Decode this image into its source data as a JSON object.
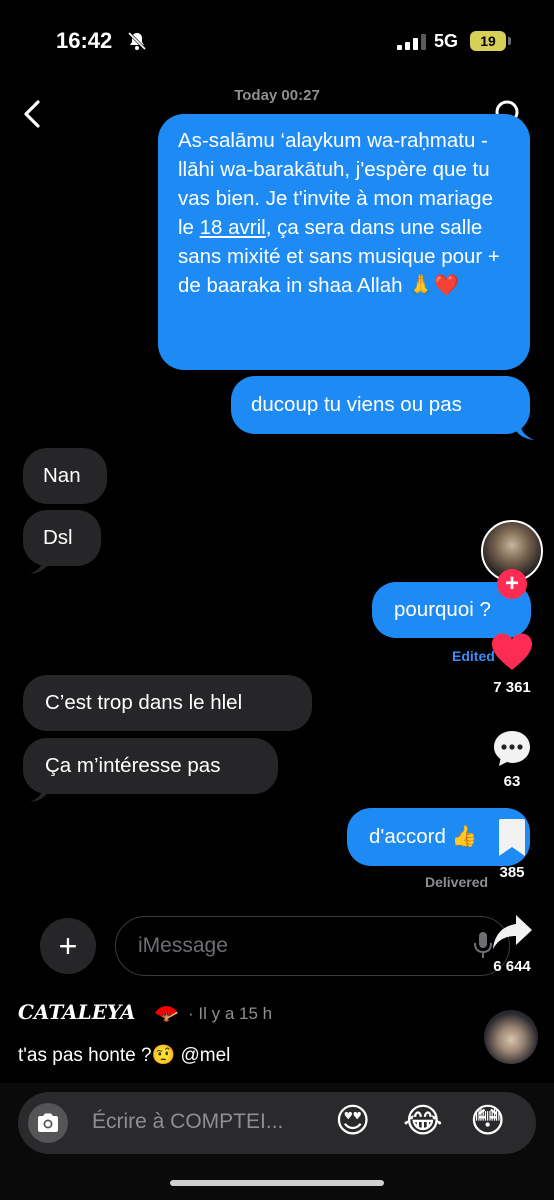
{
  "status_bar": {
    "time": "16:42",
    "network": "5G",
    "battery": "19"
  },
  "header": {
    "timestamp": "Today 00:27"
  },
  "messages": {
    "m1_pre": "As-salāmu ‘alaykum wa-raḥmatu -llāhi wa-barakātuh, j'espère que tu vas bien. Je t'invite à mon mariage le ",
    "m1_date": "18 avril",
    "m1_post": ", ça sera dans une salle sans mixité et sans musique pour + de baaraka in shaa Allah 🙏❤️",
    "m2": "ducoup tu viens ou pas",
    "m3": "Nan",
    "m4": "Dsl",
    "m5": "pourquoi ?",
    "m6": "C’est trop dans le hlel",
    "m7": "Ça m’intéresse pas",
    "m8": "d'accord 👍"
  },
  "edited_label": "Edited",
  "delivered_label": "Delivered",
  "compose": {
    "placeholder": "iMessage"
  },
  "rail": {
    "likes": "7 361",
    "comments": "63",
    "saves": "385",
    "shares": "6 644"
  },
  "comment": {
    "user": "CATALEYA",
    "user_emoji": "🪭",
    "time": "· Il y a 15 h",
    "text": "t'as pas honte ?🤨 @mel"
  },
  "bottom": {
    "placeholder": "Écrire à COMPTEI...",
    "emojis": [
      "😍",
      "😂",
      "😳"
    ]
  },
  "colors": {
    "outgoing": "#1e8bf5",
    "incoming": "#262628",
    "like": "#fe2c55"
  }
}
